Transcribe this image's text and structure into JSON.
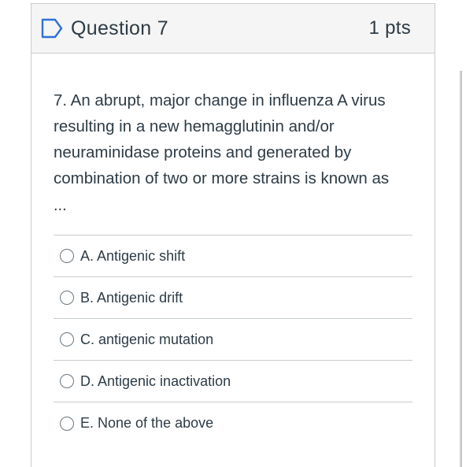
{
  "question": {
    "title": "Question 7",
    "points": "1 pts",
    "flag_icon": "flag-outline-icon",
    "text": "7. An abrupt, major change in influenza A virus resulting in a new hemagglutinin and/or neuraminidase proteins and generated by combination of two or more strains is known as",
    "ellipsis": "..."
  },
  "answers": [
    {
      "label": "A. Antigenic shift"
    },
    {
      "label": "B. Antigenic drift"
    },
    {
      "label": "C. antigenic mutation"
    },
    {
      "label": "D. Antigenic inactivation"
    },
    {
      "label": "E. None of the above"
    }
  ],
  "colors": {
    "accent": "#2d72d2",
    "text": "#2d3b45",
    "border": "#c7cdd1"
  }
}
